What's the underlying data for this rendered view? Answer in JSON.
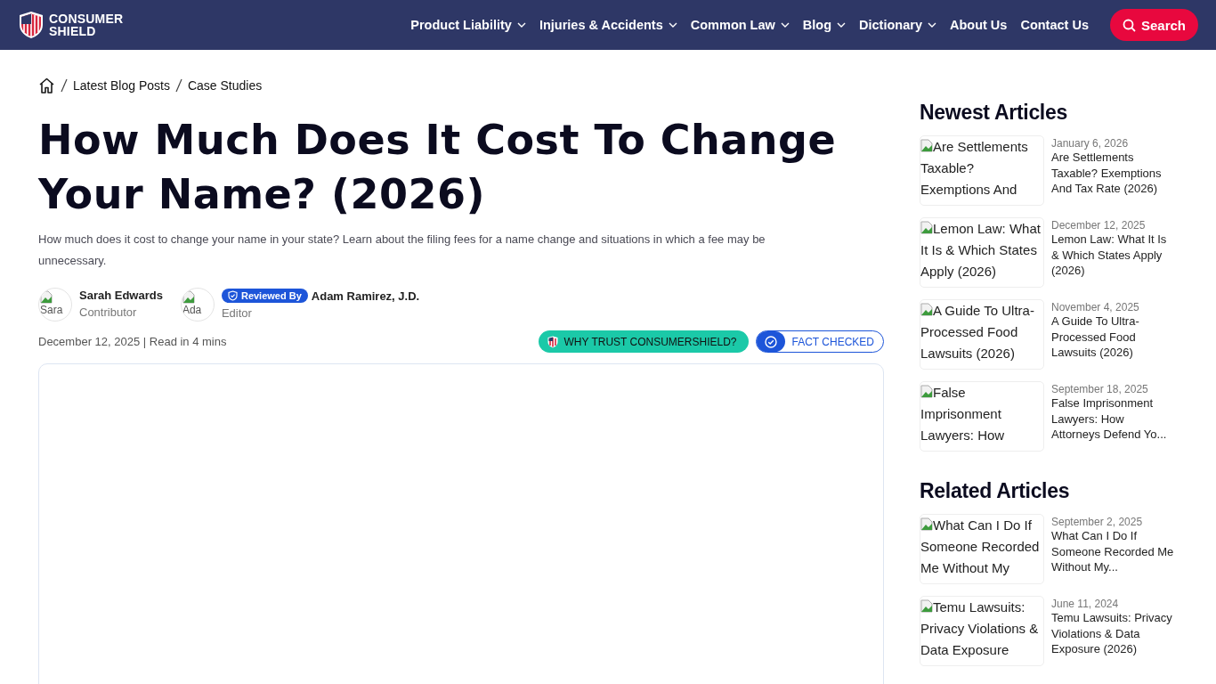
{
  "header": {
    "logo": "CONSUMER SHIELD",
    "nav": [
      {
        "label": "Product Liability",
        "has_menu": true
      },
      {
        "label": "Injuries & Accidents",
        "has_menu": true
      },
      {
        "label": "Common Law",
        "has_menu": true
      },
      {
        "label": "Blog",
        "has_menu": true
      },
      {
        "label": "Dictionary",
        "has_menu": true
      },
      {
        "label": "About Us",
        "has_menu": false
      },
      {
        "label": "Contact Us",
        "has_menu": false
      }
    ],
    "search_button": "Search"
  },
  "breadcrumb": [
    "Latest Blog Posts",
    "Case Studies"
  ],
  "article": {
    "title": "How Much Does It Cost To Change Your Name? (2026)",
    "summary": "How much does it cost to change your name in your state? Learn about the filing fees for a name change and situations in which a fee may be unnecessary.",
    "authors": [
      {
        "avatar_alt": "Sara",
        "name": "Sarah Edwards",
        "role": "Contributor"
      },
      {
        "avatar_alt": "Ada",
        "badge": "Reviewed By",
        "name": "Adam Ramirez, J.D.",
        "role": "Editor"
      }
    ],
    "meta": "December 12, 2025 | Read in 4 mins",
    "trust_button": "WHY TRUST CONSUMERSHIELD?",
    "fact_checked": "FACT CHECKED"
  },
  "sidebar": [
    {
      "heading": "Newest Articles",
      "items": [
        {
          "image_alt": "Are Settlements Taxable? Exemptions And",
          "date": "January 6, 2026",
          "title": "Are Settlements Taxable? Exemptions And Tax Rate (2026)"
        },
        {
          "image_alt": "Lemon Law: What It Is & Which States Apply (2026)",
          "date": "December 12, 2025",
          "title": "Lemon Law: What It Is & Which States Apply (2026)"
        },
        {
          "image_alt": "A Guide To Ultra-Processed Food Lawsuits (2026)",
          "date": "November 4, 2025",
          "title": "A Guide To Ultra-Processed Food Lawsuits (2026)"
        },
        {
          "image_alt": "False Imprisonment Lawyers: How",
          "date": "September 18, 2025",
          "title": "False Imprisonment Lawyers: How Attorneys Defend Yo..."
        }
      ]
    },
    {
      "heading": "Related Articles",
      "items": [
        {
          "image_alt": "What Can I Do If Someone Recorded Me Without My",
          "date": "September 2, 2025",
          "title": "What Can I Do If Someone Recorded Me Without My..."
        },
        {
          "image_alt": "Temu Lawsuits: Privacy Violations & Data Exposure",
          "date": "June 11, 2024",
          "title": "Temu Lawsuits: Privacy Violations & Data Exposure (2026)"
        }
      ]
    }
  ]
}
